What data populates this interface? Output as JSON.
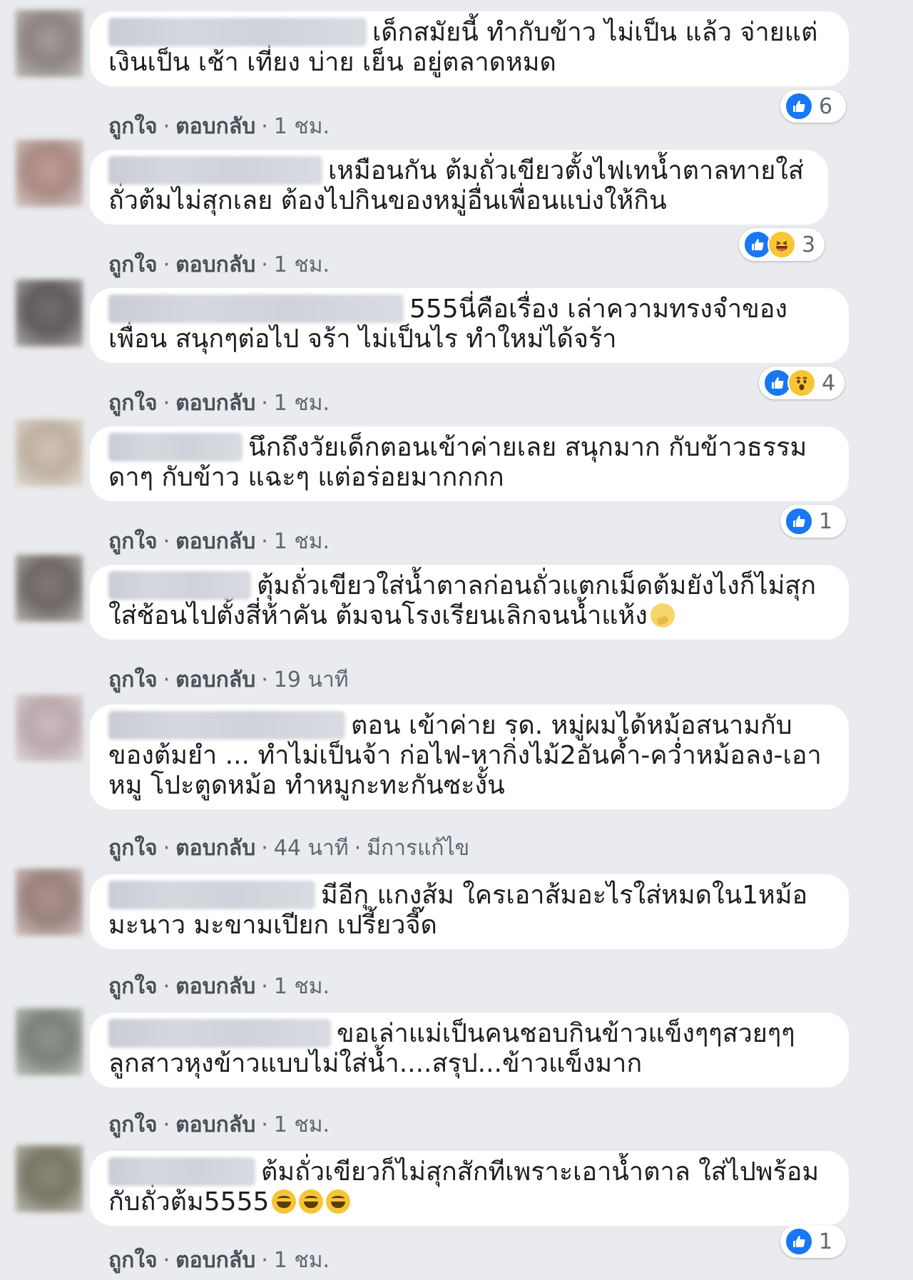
{
  "comments": [
    {
      "text": "เด็กสมัยนี้ ทำกับข้าว ไม่เป็น แล้ว จ่ายแต่เงินเป็น เช้า เที่ยง บ่าย เย็น อยู่ตลาดหมด",
      "actions": {
        "like": "ถูกใจ",
        "reply": "ตอบกลับ",
        "time": "1 ชม."
      },
      "reaction_count": "6"
    },
    {
      "text": "เหมือนกัน ต้มถั่วเขียวตั้งไฟเทน้ำตาลทายใส่ถั่วต้มไม่สุกเลย ต้องไปกินของหมู่อื่นเพื่อนแบ่งให้กิน",
      "actions": {
        "like": "ถูกใจ",
        "reply": "ตอบกลับ",
        "time": "1 ชม."
      },
      "reaction_count": "3"
    },
    {
      "text": "555นี่คือเรื่อง เล่าความทรงจำของเพื่อน สนุกๆต่อไป จร้า ไม่เป็นไร ทำใหม่ได้จร้า",
      "actions": {
        "like": "ถูกใจ",
        "reply": "ตอบกลับ",
        "time": "1 ชม."
      },
      "reaction_count": "4"
    },
    {
      "text": "นึกถึงวัยเด็กตอนเข้าค่ายเลย สนุกมาก กับข้าวธรรมดาๆ กับข้าว แฉะๆ แต่อร่อยมากกกก",
      "actions": {
        "like": "ถูกใจ",
        "reply": "ตอบกลับ",
        "time": "1 ชม."
      },
      "reaction_count": "1"
    },
    {
      "text": "ตุ้มถั่วเขียวใส่น้ำตาลก่อนถั่วแตกเม็ดต้มยังไงก็ไม่สุก ใส่ช้อนไปตั้งสี่ห้าคัน ต้มจนโรงเรียนเลิกจนน้ำแห้ง",
      "actions": {
        "like": "ถูกใจ",
        "reply": "ตอบกลับ",
        "time": "19 นาที"
      }
    },
    {
      "text": "ตอน เข้าค่าย รด. หมู่ผมได้หม้อสนามกับของต้มยำ ... ทำไม่เป็นจ้า ก่อไฟ-หากิ่งไม้2อันค้ำ-คว่ำหม้อลง-เอาหมู โปะตูดหม้อ ทำหมูกะทะกันซะงั้น",
      "actions": {
        "like": "ถูกใจ",
        "reply": "ตอบกลับ",
        "time": "44 นาที",
        "edited": "มีการแก้ไข"
      }
    },
    {
      "text": "มีอีกุ แกงส้ม ใครเอาส้มอะไรใส่หมดใน1หม้อ มะนาว มะขามเปียก เปรี้ยวจี๊ด",
      "actions": {
        "like": "ถูกใจ",
        "reply": "ตอบกลับ",
        "time": "1 ชม."
      }
    },
    {
      "text": "ขอเล่าแม่เป็นคนชอบกินข้าวแข็งๆๆสวยๆๆลูกสาวหุงข้าวแบบไม่ใส่น้ำ....สรุป...ข้าวแข็งมาก",
      "actions": {
        "like": "ถูกใจ",
        "reply": "ตอบกลับ",
        "time": "1 ชม."
      }
    },
    {
      "text": "ต้มถั่วเขียวก็ไม่สุกสักทีเพราะเอาน้ำตาล ใส่ไปพร้อมกับถั่วต้ม5555",
      "actions": {
        "like": "ถูกใจ",
        "reply": "ตอบกลับ",
        "time": "1 ชม."
      },
      "reaction_count": "1"
    }
  ],
  "separator": "·",
  "icons": {
    "like": "thumbs-up-icon",
    "haha": "haha-emoji-icon",
    "wow": "wow-emoji-icon",
    "inline_grin": "grin-emoji-icon",
    "inline_think": "thinking-emoji-icon"
  },
  "colors": {
    "background": "#e9ebee",
    "bubble": "#ffffff",
    "like_blue": "#1877f2",
    "reaction_yellow": "#f7c632",
    "meta_text": "#606770"
  }
}
